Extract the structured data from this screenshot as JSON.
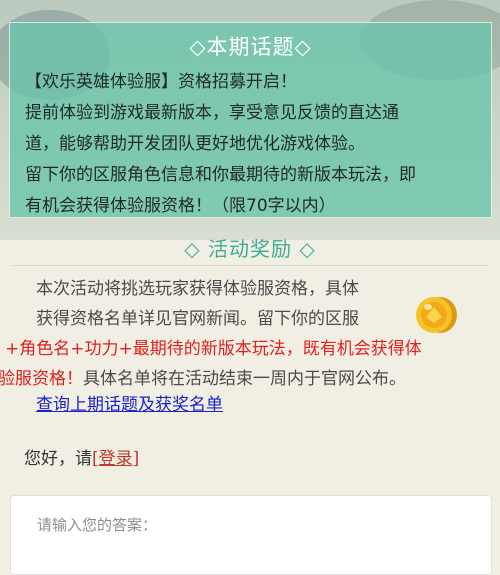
{
  "topic": {
    "title": "◇本期话题◇",
    "lines": [
      "【欢乐英雄体验服】资格招募开启！",
      "提前体验到游戏最新版本，享受意见反馈的直达通",
      "道，能够帮助开发团队更好地优化游戏体验。",
      "留下你的区服角色信息和你最期待的新版本玩法，即",
      "有机会获得体验服资格！（限70字以内）"
    ]
  },
  "reward": {
    "title": "◇ 活动奖励 ◇",
    "line1": "本次活动将挑选玩家获得体验服资格，具体",
    "line2": "获得资格名单详见官网新闻。留下你的区服",
    "line3_red": "+角色名+功力+最期待的新版本玩法，既有机会获得体",
    "line4_red": "验服资格！",
    "line4_rest": "具体名单将在活动结束一周内于官网公布。"
  },
  "links": {
    "previous": "查询上期话题及获奖名单"
  },
  "greeting": {
    "prefix": "您好，请",
    "login": "[登录]"
  },
  "answer": {
    "placeholder": "请输入您的答案："
  },
  "icons": {
    "coin": "gold-coin-icon"
  },
  "colors": {
    "topic_bg": "#68c4aa",
    "reward_title": "#3fae90",
    "highlight": "#e02020",
    "link": "#1a22c8",
    "login": "#c0392b"
  }
}
